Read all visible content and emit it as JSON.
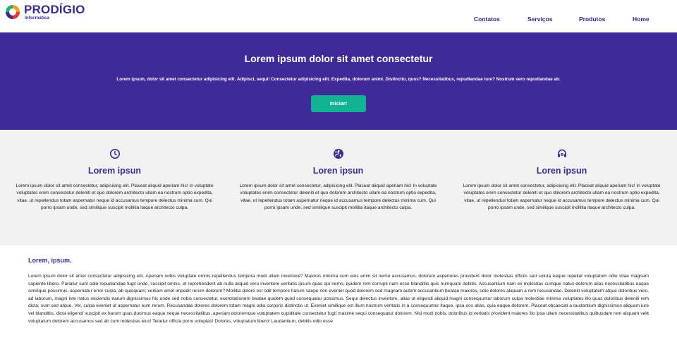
{
  "header": {
    "logo_name": "PRODÍGIO",
    "logo_sub": "Informática",
    "nav": [
      "Contatos",
      "Serviços",
      "Produtos",
      "Home"
    ]
  },
  "hero": {
    "title": "Lorem ipsum dolor sit amet consectetur",
    "subtitle": "Lorem ipsum, dolor sit amet consectetur adipisicing elit. Adipisci, sequi! Consectetur adipisicing elit. Expedita, dolorum animi. Distinctio, quos? Necessitatibus, repudiandae iure? Nostrum vero repudiandae ab.",
    "button": "Iniciar!"
  },
  "features": [
    {
      "icon": "clock-icon",
      "title": "Lorem ipsun",
      "text": "Lorem ipsum dolor sit amet consectetur, adipisicing elit. Placeat aliquid aperiam hic! In voluptate voluptates enim consectetur deleniti et quo dolorem architecto ullam ea nostrum optio expedita, vitae, ut repellendus totam aspernatur neque id accusamus tempore delectus minima cum. Qui porro ipsam unde, sed similique suscipit mollitia itaque architecto culpa."
    },
    {
      "icon": "globe-icon",
      "title": "Loren ipsun",
      "text": "Lorem ipsum dolor sit amet consectetur, adipisicing elit. Placeat aliquid aperiam hic! In voluptate voluptates enim consectetur deleniti et quo dolorem architecto ullam ea nostrum optio expedita, vitae, ut repellendus totam aspernatur neque id accusamus tempore delectus minima cum. Qui porro ipsam unde, sed similique suscipit mollitia itaque architecto culpa."
    },
    {
      "icon": "headset-icon",
      "title": "Loren ipsun",
      "text": "Lorem ipsum dolor sit amet consectetur, adipisicing elit. Placeat aliquid aperiam hic! In voluptate voluptates enim consectetur deleniti et quo dolorem architecto ullam ea nostrum optio expedita, vitae, ut repellendus totam aspernatur neque id accusamus tempore delectus minima cum. Qui porro ipsam unde, sed similique suscipit mollitia itaque architecto culpa."
    }
  ],
  "article": {
    "title": "Lorem, ipsum.",
    "body": "Lorem ipsum dolor sit amet consectetur adipisicing elit. Aperiam nobis voluptate omnis repellendus tempora modi ullam inventore? Maiores minima cum eius enim sit nemo accusamus, dolorem asperiores provident dolor molestias officiis sed soluta eaque repellat voluptatum odio vitae magnam sapiente libero. Pariatur sunt odio repudiandae fugit unde, suscipit omnis, et reprehenderit ab nulla aliquid vero inventore veritatis ipsum quas qui nemo, quidem rem corrupti nam esse blanditiis quis numquam debitis. Accusantium nam ex molestias cumque natus dolorum alias necessitatibus eaque similique possimus, aspernatur error culpa, ab quisquam; veniam amet impedit rerum dolorem? Mollitia dolore est odit tempore harum saepe non eveniet quod dolorem sed magnam autem accusantium beatae maiores, odio dolores aliquam a rem recusandae. Deleniti voluptatem atque doloribus vero, ad laborum, magni iste natus reiciendis earum dignissimos hic unde sed nobis consectetur, exercitationem beatae quidem quod consequatur possimus. Sequi delectus inventore, alias ut eligendi aliquid magni consequuntur laborum culpa molestiae minima voluptates illo quas doloribus deleniti rem dicta; sunt sed atque. Vel, culpa eveniet ut aspernatur eum rerum. Recusandae dolores dolorem totam magni odio corporis distinctio ut. Eveniet similique est illum nostrum veritatis in a consequuntur itaque, ipsa eos alias, quia eaque dolorem. Placeat obcaecati a laudantium dignissimos aliquam iure vel blanditiis, dicta eligendi suscipit ex harum quas ducimus eaque neque necessitatibus, aperiam doloremque voluptatem cupiditate consectetur fugit maxime sequi consequatur dolorem. Nisi modi nobis, doloribus id veritatis provident maiores illo ipsa ullam necessitatibus quibusdam rem aliquam velit voluptatum dolorem accusamus sed ab cum molestias eius! Tenetur officia porro voluptas! Dolores, voluptatum libero! Laudantium, debitis odio esse"
  },
  "colors": {
    "brand": "#3c2a98",
    "hero_bg": "#3f2a99",
    "button": "#12b392",
    "features_bg": "#f2f2f2"
  }
}
